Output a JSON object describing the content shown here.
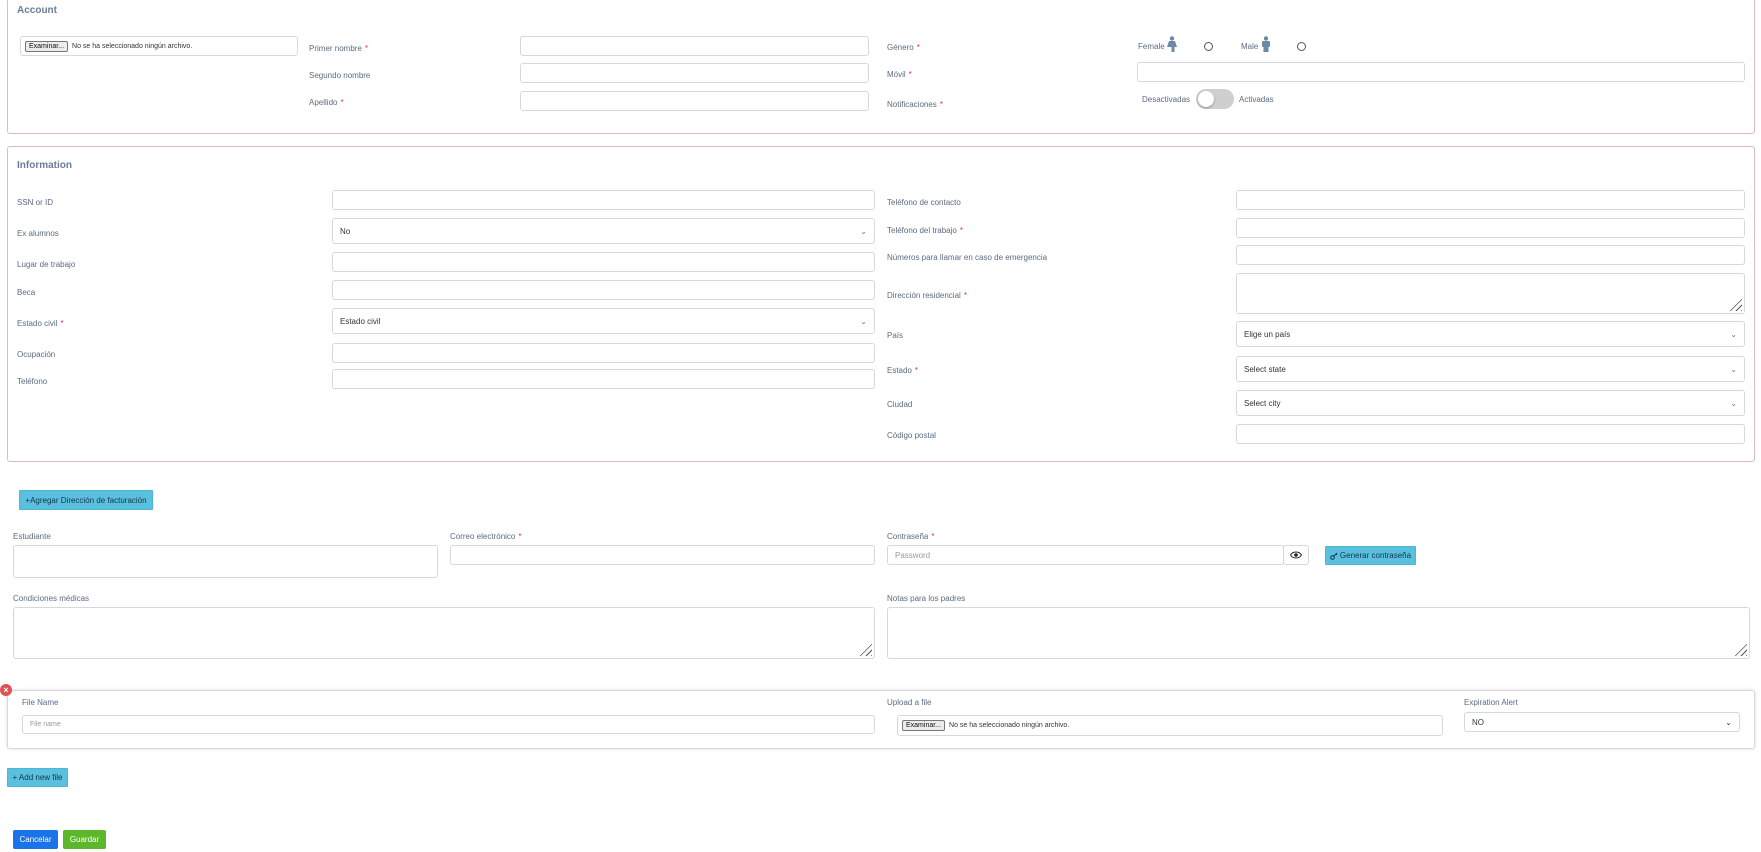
{
  "account": {
    "title": "Account",
    "photo_file": {
      "button": "Examinar...",
      "status": "No se ha seleccionado ningún archivo."
    },
    "first_name_label": "Primer nombre",
    "middle_name_label": "Segundo nombre",
    "last_name_label": "Apellido",
    "gender_label": "Género",
    "gender_female": "Female",
    "gender_male": "Male",
    "mobile_label": "Móvil",
    "notifications_label": "Notificaciones",
    "notif_off": "Desactivadas",
    "notif_on": "Activadas",
    "required_mark": "*"
  },
  "information": {
    "title": "Information",
    "ssn_label": "SSN or ID",
    "alumni_label": "Ex alumnos",
    "alumni_value": "No",
    "workplace_label": "Lugar de trabajo",
    "scholarship_label": "Beca",
    "marital_label": "Estado civil",
    "marital_value": "Estado civil",
    "occupation_label": "Ocupación",
    "phone_label": "Teléfono",
    "contact_phone_label": "Teléfono de contacto",
    "work_phone_label": "Teléfono del trabajo",
    "emergency_label": "Números para llamar en caso de emergencia",
    "address_label": "Dirección residencial",
    "country_label": "País",
    "country_value": "Elige un país",
    "state_label": "Estado",
    "state_value": "Select state",
    "city_label": "Ciudad",
    "city_value": "Select city",
    "zip_label": "Código postal"
  },
  "billing": {
    "add_button": "+Agregar Dirección de facturación"
  },
  "student": {
    "student_label": "Estudiante",
    "email_label": "Correo electrónico",
    "password_label": "Contraseña",
    "password_placeholder": "Password",
    "generate_button": "Generar contraseña",
    "medical_label": "Condiciones médicas",
    "parent_notes_label": "Notas para los padres"
  },
  "files": {
    "file_name_label": "File Name",
    "file_name_placeholder": "File name",
    "upload_label": "Upload a file",
    "upload_button": "Examinar...",
    "upload_status": "No se ha seleccionado ningún archivo.",
    "expiration_label": "Expiration Alert",
    "expiration_value": "NO",
    "add_new_button": "+ Add new file"
  },
  "actions": {
    "cancel": "Cancelar",
    "save": "Guardar"
  },
  "colors": {
    "info": "#5bc0de",
    "primary": "#1a73e8",
    "success": "#5cb82a",
    "required": "#d9334a",
    "section_border": "#e2b9bf"
  }
}
